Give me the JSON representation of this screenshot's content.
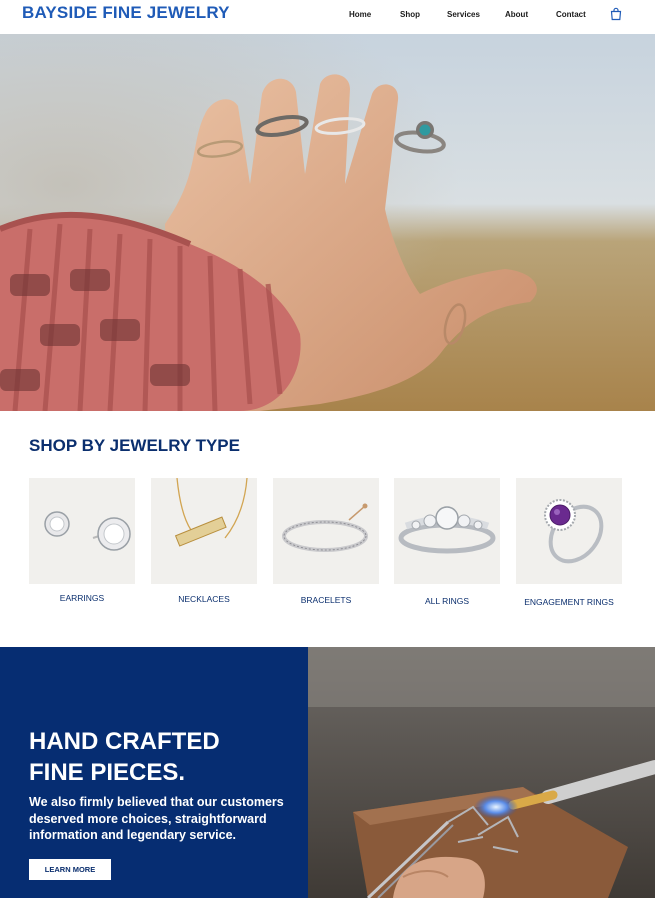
{
  "header": {
    "logo": "BAYSIDE FINE JEWELRY",
    "nav": [
      "Home",
      "Shop",
      "Services",
      "About",
      "Contact"
    ],
    "cart_icon": "shopping-bag-icon"
  },
  "hero": {
    "image": "hand-with-rings-photo"
  },
  "shop_by_type": {
    "title": "SHOP BY JEWELRY TYPE",
    "items": [
      {
        "label": "EARRINGS",
        "icon": "earrings-image"
      },
      {
        "label": "NECKLACES",
        "icon": "necklace-image"
      },
      {
        "label": "BRACELETS",
        "icon": "bracelet-image"
      },
      {
        "label": "ALL RINGS",
        "icon": "ring-image"
      },
      {
        "label": "ENGAGEMENT RINGS",
        "icon": "engagement-ring-image"
      }
    ]
  },
  "handcrafted": {
    "title_line1": "HAND CRAFTED",
    "title_line2": "FINE PIECES.",
    "body": "We also firmly believed that our customers deserved more choices, straightforward information and legendary service.",
    "button": "LEARN MORE",
    "image": "jeweler-soldering-photo"
  },
  "colors": {
    "brand_blue": "#1f5bb7",
    "navy": "#062d72",
    "tile_bg": "#f1f0ed"
  }
}
